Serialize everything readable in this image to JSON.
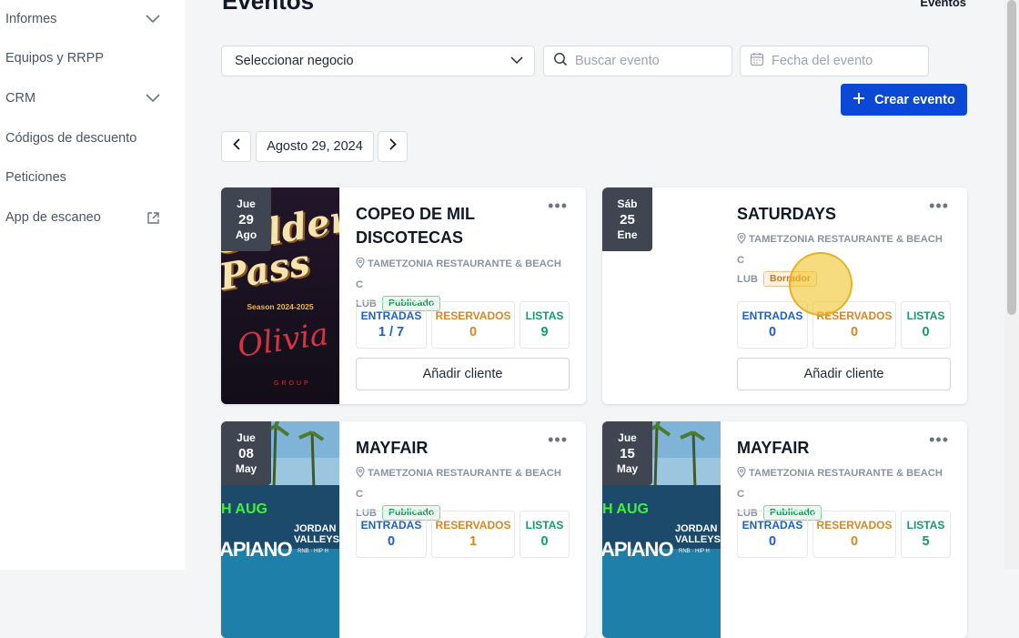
{
  "sidebar": {
    "items": [
      {
        "label": "Informes",
        "icon": "chevron-down-icon"
      },
      {
        "label": "Equipos y RRPP"
      },
      {
        "label": "CRM",
        "icon": "chevron-down-icon"
      },
      {
        "label": "Códigos de descuento"
      },
      {
        "label": "Peticiones"
      },
      {
        "label": "App de escaneo",
        "icon": "external-link-icon"
      }
    ]
  },
  "header": {
    "title": "Eventos",
    "top_right": "Eventos"
  },
  "filters": {
    "business_select": "Seleccionar negocio",
    "search_placeholder": "Buscar evento",
    "date_placeholder": "Fecha del evento"
  },
  "actions": {
    "create_label": "Crear evento"
  },
  "date_nav": {
    "current": "Agosto 29, 2024"
  },
  "colors": {
    "primary": "#0b48d6",
    "entradas": "#1d5fc9",
    "reservados": "#d98624",
    "listas": "#149a6e",
    "badge_bg": "#3f4651"
  },
  "events": [
    {
      "dow": "Jue",
      "day": "29",
      "month": "Ago",
      "title": "COPEO DE MIL DISCOTECAS",
      "venue_line1": "TAMETZONIA RESTAURANTE & BEACH C",
      "venue_line2": "LUB",
      "status": "Publicado",
      "entradas_label": "ENTRADAS",
      "entradas": "1 / 7",
      "reservados_label": "RESERVADOS",
      "reservados": "0",
      "listas_label": "LISTAS",
      "listas": "9",
      "add_label": "Añadir cliente",
      "poster": {
        "big_text": "Golden Pass",
        "season": "Season 2024-2025",
        "script": "Olivia",
        "group": "GROUP"
      }
    },
    {
      "dow": "Sáb",
      "day": "25",
      "month": "Ene",
      "title": "SATURDAYS",
      "venue_line1": "TAMETZONIA RESTAURANTE & BEACH C",
      "venue_line2": "LUB",
      "status": "Borrador",
      "entradas_label": "ENTRADAS",
      "entradas": "0",
      "reservados_label": "RESERVADOS",
      "reservados": "0",
      "listas_label": "LISTAS",
      "listas": "0",
      "add_label": "Añadir cliente"
    },
    {
      "dow": "Jue",
      "day": "08",
      "month": "May",
      "title": "MAYFAIR",
      "venue_line1": "TAMETZONIA RESTAURANTE & BEACH C",
      "venue_line2": "LUB",
      "status": "Publicado",
      "entradas_label": "ENTRADAS",
      "entradas": "0",
      "reservados_label": "RESERVADOS",
      "reservados": "1",
      "listas_label": "LISTAS",
      "listas": "0",
      "poster": {
        "aug": "H AUG",
        "piano": "APIANO",
        "jordan": "JORDAN",
        "valleys": "VALLEYS",
        "genre": "RNB · HIP H"
      }
    },
    {
      "dow": "Jue",
      "day": "15",
      "month": "May",
      "title": "MAYFAIR",
      "venue_line1": "TAMETZONIA RESTAURANTE & BEACH C",
      "venue_line2": "LUB",
      "status": "Publicado",
      "entradas_label": "ENTRADAS",
      "entradas": "0",
      "reservados_label": "RESERVADOS",
      "reservados": "0",
      "listas_label": "LISTAS",
      "listas": "5",
      "poster": {
        "aug": "H AUG",
        "piano": "APIANO",
        "jordan": "JORDAN",
        "valleys": "VALLEYS",
        "genre": "RNB · HIP H"
      }
    }
  ]
}
